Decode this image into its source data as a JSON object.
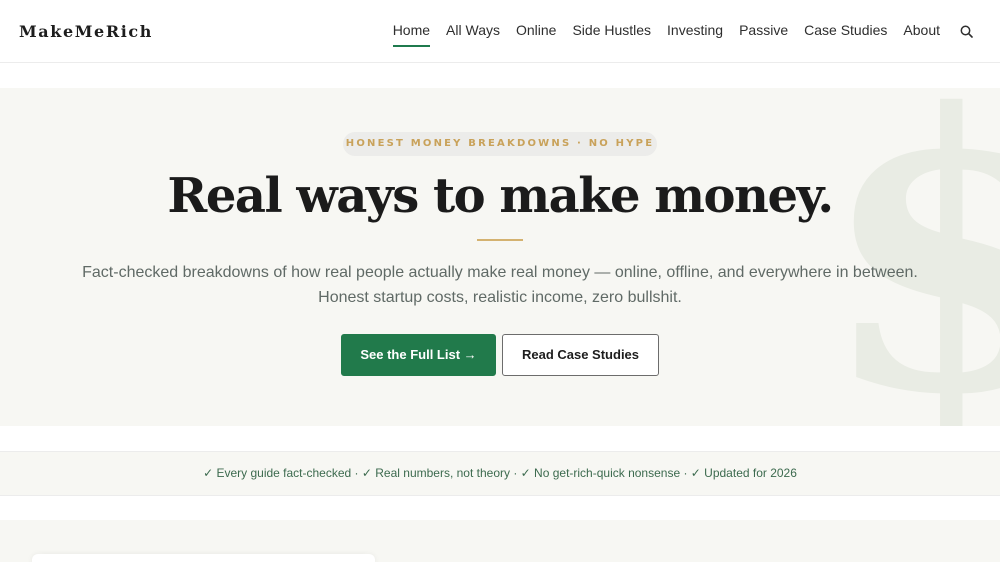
{
  "header": {
    "logo": "MakeMeRich",
    "nav": [
      {
        "label": "Home",
        "active": true
      },
      {
        "label": "All Ways",
        "active": false
      },
      {
        "label": "Online",
        "active": false
      },
      {
        "label": "Side Hustles",
        "active": false
      },
      {
        "label": "Investing",
        "active": false
      },
      {
        "label": "Passive",
        "active": false
      },
      {
        "label": "Case Studies",
        "active": false
      },
      {
        "label": "About",
        "active": false
      }
    ],
    "search_icon": "search-icon"
  },
  "hero": {
    "eyebrow": "HONEST MONEY BREAKDOWNS · NO HYPE",
    "title": "Real ways to make money.",
    "subtitle": "Fact-checked breakdowns of how real people actually make real money — online, offline, and everywhere in between. Honest startup costs, realistic income, zero bullshit.",
    "primary_button": "See the Full List →",
    "secondary_button": "Read Case Studies",
    "background_icon": "dollar-sign-icon"
  },
  "trust_strip": {
    "text": "✓ Every guide fact-checked · ✓ Real numbers, not theory · ✓ No get-rich-quick nonsense · ✓ Updated for 2026"
  },
  "colors": {
    "accent_green": "#217a4b",
    "gold": "#d4b270",
    "hero_background": "#f7f7f3"
  }
}
